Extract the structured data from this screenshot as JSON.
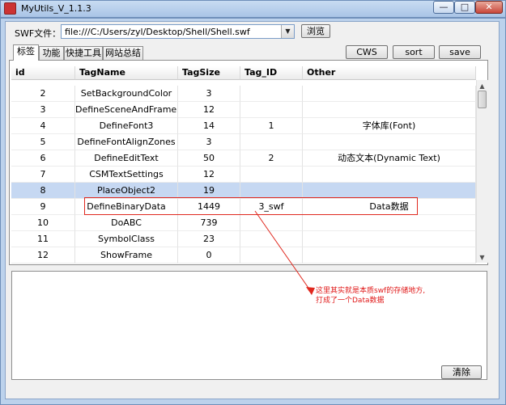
{
  "window": {
    "title": "MyUtils_V_1.1.3",
    "controls": {
      "minimize": "—",
      "maximize": "□",
      "close": "✕"
    }
  },
  "swf": {
    "label": "SWF文件：",
    "path": "file:///C:/Users/zyl/Desktop/Shell/Shell.swf",
    "browse": "浏览"
  },
  "tabs": [
    "标签",
    "功能",
    "快捷工具",
    "网站总结"
  ],
  "actions": {
    "cws": "CWS",
    "sort": "sort",
    "save": "save"
  },
  "table": {
    "columns": [
      "id",
      "TagName",
      "TagSize",
      "Tag_ID",
      "Other"
    ],
    "rows": [
      {
        "id": "2",
        "name": "SetBackgroundColor",
        "size": "3",
        "tag_id": "",
        "other": ""
      },
      {
        "id": "3",
        "name": "DefineSceneAndFrameLabe",
        "size": "12",
        "tag_id": "",
        "other": ""
      },
      {
        "id": "4",
        "name": "DefineFont3",
        "size": "14",
        "tag_id": "1",
        "other": "字体库(Font)"
      },
      {
        "id": "5",
        "name": "DefineFontAlignZones",
        "size": "3",
        "tag_id": "",
        "other": ""
      },
      {
        "id": "6",
        "name": "DefineEditText",
        "size": "50",
        "tag_id": "2",
        "other": "动态文本(Dynamic Text)"
      },
      {
        "id": "7",
        "name": "CSMTextSettings",
        "size": "12",
        "tag_id": "",
        "other": ""
      },
      {
        "id": "8",
        "name": "PlaceObject2",
        "size": "19",
        "tag_id": "",
        "other": ""
      },
      {
        "id": "9",
        "name": "DefineBinaryData",
        "size": "1449",
        "tag_id": "3_swf",
        "other": "Data数据"
      },
      {
        "id": "10",
        "name": "DoABC",
        "size": "739",
        "tag_id": "",
        "other": ""
      },
      {
        "id": "11",
        "name": "SymbolClass",
        "size": "23",
        "tag_id": "",
        "other": ""
      },
      {
        "id": "12",
        "name": "ShowFrame",
        "size": "0",
        "tag_id": "",
        "other": ""
      }
    ],
    "selected_index": 6
  },
  "annotation": {
    "line1": "这里其实就是本质swf的存储地方,",
    "line2": "打成了一个Data数据"
  },
  "clear_button": "清除",
  "colors": {
    "selected_row": "#c6d8f2",
    "highlight_box": "#e0281e",
    "annotation": "#e01818"
  },
  "icons": {
    "app": "app-icon",
    "dropdown": "chevron-down-icon",
    "scroll_up": "arrow-up-icon",
    "scroll_down": "arrow-down-icon"
  }
}
